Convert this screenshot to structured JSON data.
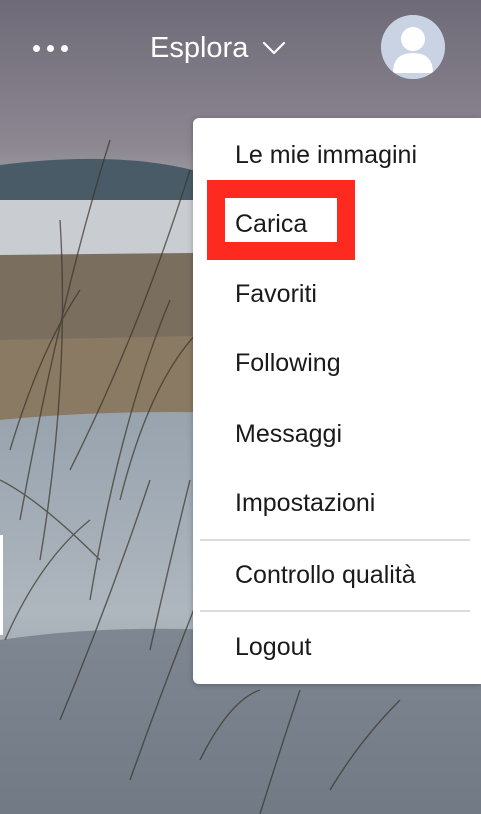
{
  "header": {
    "more_icon": "more-dots-icon",
    "explore_label": "Esplora",
    "explore_icon": "chevron-down-icon",
    "avatar_icon": "user-avatar-icon"
  },
  "menu": {
    "items": [
      {
        "label": "Le mie immagini"
      },
      {
        "label": "Carica"
      },
      {
        "label": "Favoriti"
      },
      {
        "label": "Following"
      },
      {
        "label": "Messaggi"
      },
      {
        "label": "Impostazioni"
      },
      {
        "label": "Controllo qualità"
      },
      {
        "label": "Logout"
      }
    ],
    "highlighted_item": "Carica"
  },
  "colors": {
    "highlight": "#ff2a1f",
    "menu_bg": "#ffffff",
    "header_text": "#ffffff",
    "avatar_bg": "#cfd8e6"
  }
}
